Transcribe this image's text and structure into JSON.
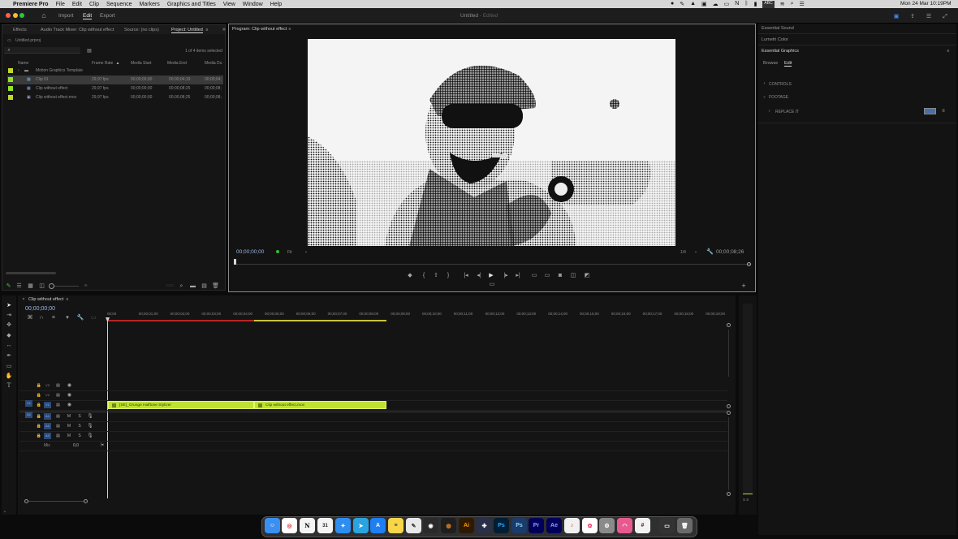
{
  "menubar": {
    "apple": "",
    "items": [
      "Premiere Pro",
      "File",
      "Edit",
      "Clip",
      "Sequence",
      "Markers",
      "Graphics and Titles",
      "View",
      "Window",
      "Help"
    ],
    "status": [
      "ABC"
    ],
    "datetime": "Mon 24 Mar  10:19PM"
  },
  "window": {
    "title": "Untitled",
    "title_suffix": "- Edited",
    "nav": [
      "Import",
      "Edit",
      "Export"
    ]
  },
  "project": {
    "tabs": [
      "Effects",
      "Audio Track Mixer: Clip without effect",
      "Source: (no clips)",
      "Project: Untitled"
    ],
    "file": "Untitled.prproj",
    "items_selected": "1 of 4 items selected",
    "columns": [
      "Name",
      "Frame Rate",
      "Media Start",
      "Media End",
      "Media Du"
    ],
    "rows": [
      {
        "name": "Motion Graphics Template",
        "rate": "",
        "start": "",
        "end": "",
        "dur": "",
        "color": "#c4d82b"
      },
      {
        "name": "Clip 01",
        "rate": "29,97 fps",
        "start": "00;00;00;00",
        "end": "00;00;04;19",
        "dur": "00;00;04;",
        "color": "#93e22b"
      },
      {
        "name": "Clip without effect",
        "rate": "29,97 fps",
        "start": "00;00;00;00",
        "end": "00;00;08;25",
        "dur": "00;00;08;",
        "color": "#93e22b"
      },
      {
        "name": "Clip without effect.mov",
        "rate": "29,97 fps",
        "start": "00;00;00;00",
        "end": "00;00;08;25",
        "dur": "00;00;08;",
        "color": "#c4d82b"
      }
    ]
  },
  "program": {
    "tab": "Program: Clip without effect",
    "timecode": "00;00;00;00",
    "fit": "Fit",
    "ratio": "1/4",
    "duration": "00;00;08;26"
  },
  "essential": {
    "panels": [
      "Essential Sound",
      "Lumetri Color",
      "Essential Graphics"
    ],
    "tabs": [
      "Browse",
      "Edit"
    ],
    "sections": [
      "CONTROLS",
      "FOOTAGE"
    ],
    "item": "REPLACE IT"
  },
  "timeline": {
    "tab": "Clip without effect",
    "timecode": "00;00;00;00",
    "ruler": [
      "00;00",
      "00;00;01;00",
      "00;00;02;00",
      "00;00;03;00",
      "00;00;04;00",
      "00;00;05;00",
      "00;00;06;00",
      "00;00;07;00",
      "00;00;08;00",
      "00;00;09;00",
      "00;00;10;00",
      "00;00;11;00",
      "00;00;12;00",
      "00;00;13;00",
      "00;00;14;00",
      "00;00;15;00",
      "00;00;16;00",
      "00;00;17;00",
      "00;00;18;00",
      "00;00;19;00"
    ],
    "video_tracks": [
      "V3",
      "V2",
      "V1"
    ],
    "audio_tracks": [
      "A1",
      "A2",
      "A3"
    ],
    "src_v": "V1",
    "src_a": "A1",
    "mix_label": "Mix",
    "mix_value": "0,0",
    "clips": [
      {
        "label": "[SE]_Grunge Halftone Stylizer"
      },
      {
        "label": "Clip without effect.mov"
      }
    ],
    "meter": "S S"
  },
  "dock": [
    "Finder",
    "Chrome",
    "Notion",
    "Calendar",
    "Safari",
    "Telegram",
    "App Store",
    "Notes",
    "Script",
    "Sonar",
    "Blender",
    "Ai",
    "Ps",
    "Ps",
    "Pr",
    "Ae",
    "Music",
    "Photos",
    "Settings",
    "Arc",
    "Slack",
    "Screen",
    "Trash"
  ]
}
